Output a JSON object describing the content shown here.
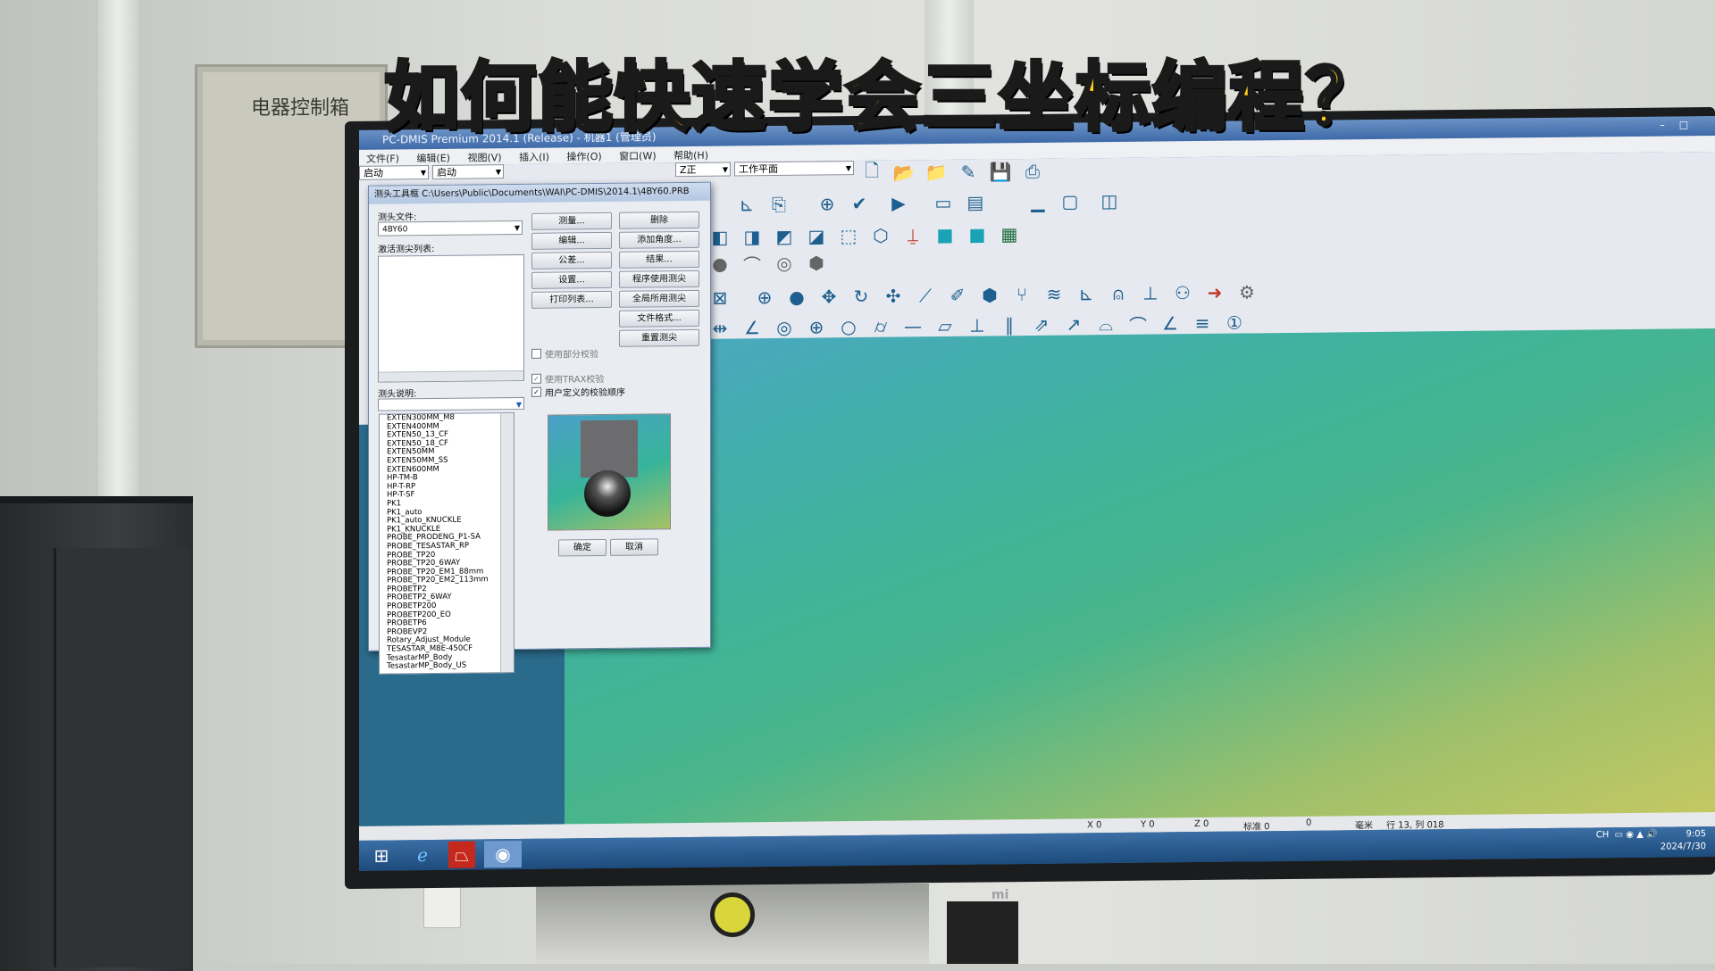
{
  "headline": "如何能快速学会三坐标编程？",
  "room": {
    "panel_label": "电器控制箱",
    "monitor_brand": "mi"
  },
  "app": {
    "title": "PC-DMIS Premium 2014.1 (Release) - 机器1 (管理员)",
    "menu": [
      "文件(F)",
      "编辑(E)",
      "视图(V)",
      "插入(I)",
      "操作(O)",
      "窗口(W)",
      "帮助(H)"
    ],
    "combos": {
      "mode1": "启动",
      "mode2": "启动",
      "axis": "Z正",
      "plane": "工作平面"
    }
  },
  "dialog": {
    "title": "测头工具框 C:\\Users\\Public\\Documents\\WAI\\PC-DMIS\\2014.1\\4BY60.PRB",
    "probe_file_label": "测头文件:",
    "probe_file_value": "4BY60",
    "active_tips_label": "激活测尖列表:",
    "probe_desc_label": "测头说明:",
    "buttons_left": [
      "测量...",
      "编辑...",
      "公差...",
      "设置...",
      "打印列表..."
    ],
    "buttons_right": [
      "删除",
      "添加角度...",
      "结果...",
      "程序使用测尖",
      "全局所用测尖",
      "文件格式...",
      "重置测尖"
    ],
    "check_partial": "使用部分校验",
    "check_trax": "使用TRAX校验",
    "check_user_order": "用户定义的校验顺序",
    "ok": "确定",
    "cancel": "取消",
    "probe_list": [
      "EXTEN300MM_M8",
      "EXTEN400MM",
      "EXTEN50_13_CF",
      "EXTEN50_18_CF",
      "EXTEN50MM",
      "EXTEN50MM_SS",
      "EXTEN600MM",
      "HP-TM-B",
      "HP-T-RP",
      "HP-T-SF",
      "PK1",
      "PK1_auto",
      "PK1_auto_KNUCKLE",
      "PK1_KNUCKLE",
      "PROBE_PRODENG_P1-SA",
      "PROBE_TESASTAR_RP",
      "PROBE_TP20",
      "PROBE_TP20_6WAY",
      "PROBE_TP20_EM1_88mm",
      "PROBE_TP20_EM2_113mm",
      "PROBETP2",
      "PROBETP2_6WAY",
      "PROBETP200",
      "PROBETP200_EO",
      "PROBETP6",
      "PROBEVP2",
      "Rotary_Adjust_Module",
      "TESASTAR_M8E-450CF",
      "TesastarMP_Body",
      "TesastarMP_Body_US"
    ]
  },
  "statusbar": {
    "x": "X 0",
    "y": "Y 0",
    "z": "Z 0",
    "mark": "标准 0",
    "zero": "0",
    "unit": "毫米",
    "pos": "行 13, 列 018"
  },
  "tray": {
    "time": "9:05",
    "date": "2024/7/30",
    "lang": "CH"
  }
}
